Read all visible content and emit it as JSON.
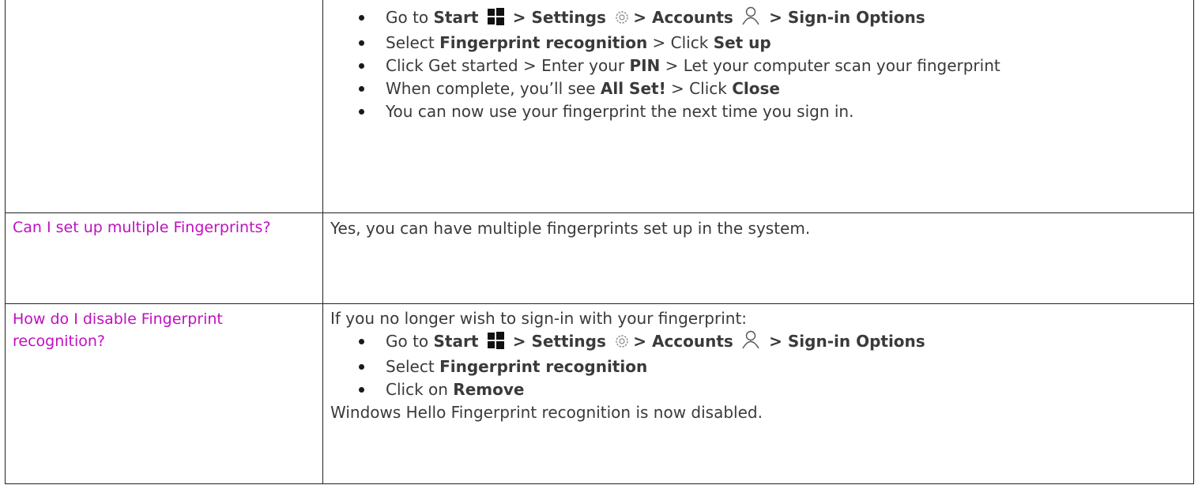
{
  "row1": {
    "steps": [
      {
        "parts": [
          "Go to ",
          "Start",
          " > ",
          "Settings",
          "> ",
          "Accounts",
          " > ",
          "Sign-in Options"
        ]
      },
      {
        "parts": [
          "Select ",
          "Fingerprint recognition",
          " > Click ",
          "Set up"
        ]
      },
      {
        "parts": [
          "Click Get started > Enter your ",
          "PIN",
          " > Let your computer scan your fingerprint"
        ]
      },
      {
        "parts": [
          "When complete, you’ll see ",
          "All Set!",
          " > Click ",
          "Close"
        ]
      },
      {
        "parts": [
          "You can now use your fingerprint the next time you sign in."
        ]
      }
    ]
  },
  "row2": {
    "question": "Can I set up multiple Fingerprints?",
    "answer": "Yes, you can have multiple fingerprints set up in the system."
  },
  "row3": {
    "question": "How do I disable Fingerprint recognition?",
    "intro": "If you no longer wish to sign-in with your fingerprint:",
    "steps": [
      {
        "parts": [
          "Go to ",
          "Start",
          " > ",
          "Settings",
          "> ",
          "Accounts",
          " > ",
          "Sign-in Options"
        ]
      },
      {
        "parts": [
          "Select ",
          "Fingerprint recognition"
        ]
      },
      {
        "parts": [
          "Click on ",
          "Remove"
        ]
      }
    ],
    "outro": "Windows Hello Fingerprint recognition is now disabled."
  },
  "icons": {
    "start": "windows-start-icon",
    "settings": "gear-icon",
    "accounts": "person-icon"
  },
  "colors": {
    "question": "#c010c0",
    "text": "#3a3a3a",
    "border": "#222222"
  }
}
